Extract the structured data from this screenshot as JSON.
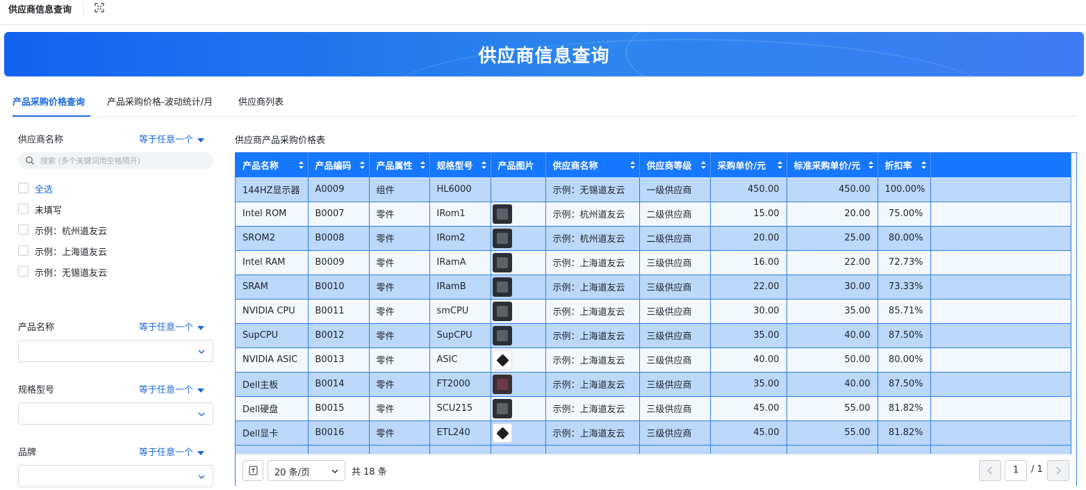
{
  "topbar": {
    "title": "供应商信息查询"
  },
  "banner": {
    "title": "供应商信息查询"
  },
  "tabs": [
    {
      "label": "产品采购价格查询",
      "active": true
    },
    {
      "label": "产品采购价格-波动统计/月",
      "active": false
    },
    {
      "label": "供应商列表",
      "active": false
    }
  ],
  "filters": {
    "supplier": {
      "label": "供应商名称",
      "mode": "等于任意一个",
      "search_placeholder": "搜索 (多个关键词用空格隔开)",
      "options": [
        "全选",
        "未填写",
        "示例：杭州道友云",
        "示例：上海道友云",
        "示例：无锡道友云"
      ]
    },
    "product": {
      "label": "产品名称",
      "mode": "等于任意一个"
    },
    "spec": {
      "label": "规格型号",
      "mode": "等于任意一个"
    },
    "brand": {
      "label": "品牌",
      "mode": "等于任意一个"
    }
  },
  "table": {
    "title": "供应商产品采购价格表",
    "columns": [
      "产品名称",
      "产品编码",
      "产品属性",
      "规格型号",
      "产品图片",
      "供应商名称",
      "供应商等级",
      "采购单价/元",
      "标准采购单价/元",
      "折扣率"
    ],
    "rows": [
      [
        "144HZ显示器",
        "A0009",
        "组件",
        "HL6000",
        "",
        "示例：无锡道友云",
        "一级供应商",
        "450.00",
        "450.00",
        "100.00%"
      ],
      [
        "Intel ROM",
        "B0007",
        "零件",
        "IRom1",
        "chip-dark",
        "示例：杭州道友云",
        "二级供应商",
        "15.00",
        "20.00",
        "75.00%"
      ],
      [
        "SROM2",
        "B0008",
        "零件",
        "IRom2",
        "chip-dark",
        "示例：杭州道友云",
        "二级供应商",
        "20.00",
        "25.00",
        "80.00%"
      ],
      [
        "Intel RAM",
        "B0009",
        "零件",
        "IRamA",
        "chip-dark",
        "示例：上海道友云",
        "三级供应商",
        "16.00",
        "22.00",
        "72.73%"
      ],
      [
        "SRAM",
        "B0010",
        "零件",
        "IRamB",
        "chip-dark",
        "示例：上海道友云",
        "三级供应商",
        "22.00",
        "30.00",
        "73.33%"
      ],
      [
        "NVIDIA CPU",
        "B0011",
        "零件",
        "smCPU",
        "chip-dark",
        "示例：上海道友云",
        "三级供应商",
        "30.00",
        "35.00",
        "85.71%"
      ],
      [
        "SupCPU",
        "B0012",
        "零件",
        "SupCPU",
        "chip-dark",
        "示例：上海道友云",
        "三级供应商",
        "35.00",
        "40.00",
        "87.50%"
      ],
      [
        "NVIDIA ASIC",
        "B0013",
        "零件",
        "ASIC",
        "chip-white",
        "示例：上海道友云",
        "三级供应商",
        "40.00",
        "50.00",
        "80.00%"
      ],
      [
        "Dell主板",
        "B0014",
        "零件",
        "FT2000",
        "chip-board",
        "示例：上海道友云",
        "三级供应商",
        "35.00",
        "40.00",
        "87.50%"
      ],
      [
        "Dell硬盘",
        "B0015",
        "零件",
        "SCU215",
        "chip-dark",
        "示例：上海道友云",
        "三级供应商",
        "45.00",
        "55.00",
        "81.82%"
      ],
      [
        "Dell显卡",
        "B0016",
        "零件",
        "ETL240",
        "chip-white",
        "示例：上海道友云",
        "三级供应商",
        "45.00",
        "55.00",
        "81.82%"
      ]
    ]
  },
  "pager": {
    "page_size": "20 条/页",
    "total": "共 18 条",
    "current_page": "1",
    "of_pages": "/ 1"
  },
  "colors": {
    "accent": "#1668dc",
    "header": "#1677ff",
    "row_odd": "#bcd8fb",
    "row_even": "#f3f8ff"
  },
  "icons": {
    "expand": "expand-icon",
    "search": "search-icon",
    "sort": "sort-icon",
    "chevron": "chevron-down-icon"
  }
}
